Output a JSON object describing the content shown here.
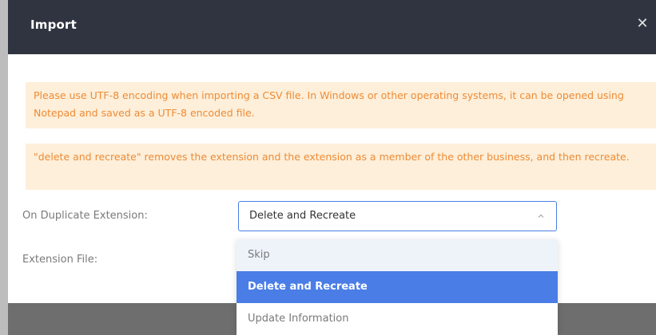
{
  "dialog": {
    "title": "Import",
    "close_glyph": "✕"
  },
  "alerts": {
    "utf8_notice": "Please use UTF-8 encoding when importing a CSV file. In Windows or other operating systems, it can be opened using Notepad and saved as a UTF-8 encoded file.",
    "delete_notice": "\"delete and recreate\" removes the extension and the extension as a member of the other business, and then recreate."
  },
  "form": {
    "duplicate_label": "On Duplicate Extension:",
    "file_label": "Extension File:",
    "duplicate_select": {
      "selected": "Delete and Recreate",
      "options": [
        "Skip",
        "Delete and Recreate",
        "Update Information"
      ]
    }
  },
  "colors": {
    "header_bg": "#2f3440",
    "alert_bg": "#fdefd9",
    "alert_text": "#ee8b36",
    "accent": "#4a7ee6"
  },
  "icons": {
    "close": "close-icon",
    "select_arrow": "chevron-up-icon"
  }
}
